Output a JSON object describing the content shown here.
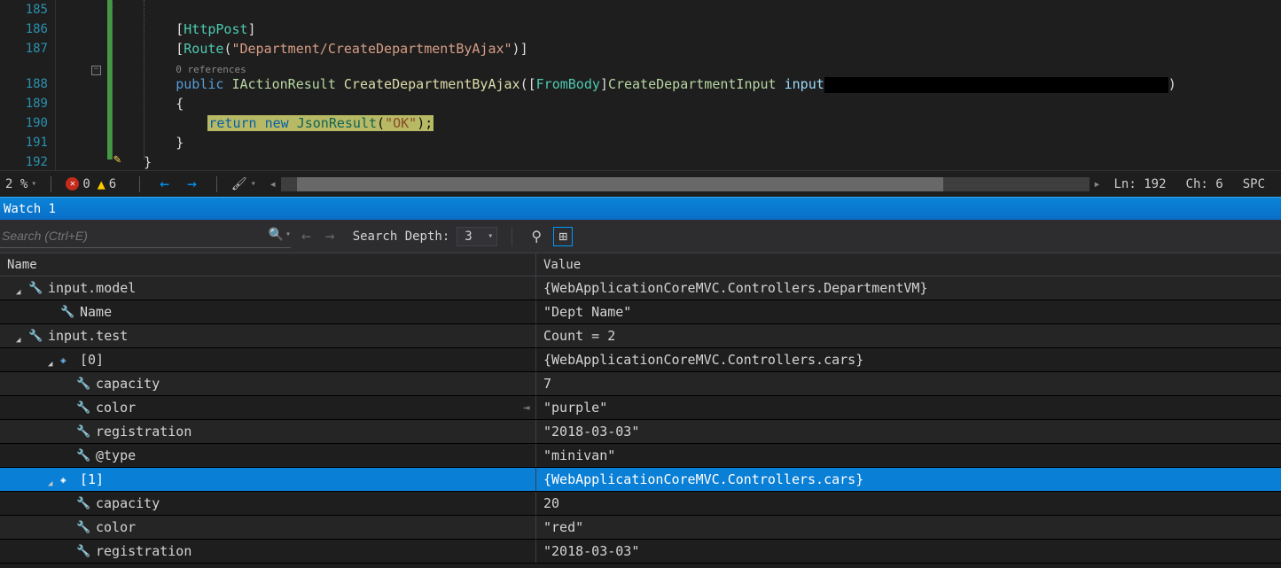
{
  "editor": {
    "lines": [
      "185",
      "186",
      "187",
      "188",
      "189",
      "190",
      "191",
      "192"
    ],
    "codelens": "0 references",
    "attr_httppost": "HttpPost",
    "attr_route": "Route",
    "route_str": "\"Department/CreateDepartmentByAjax\"",
    "kw_public": "public",
    "type_iactionresult": "IActionResult",
    "method_name": "CreateDepartmentByAjax",
    "attr_frombody": "FromBody",
    "type_input": "CreateDepartmentInput",
    "param_input": "input",
    "open_brace": "{",
    "kw_return": "return",
    "kw_new": "new",
    "type_jsonresult": "JsonResult",
    "ok_str": "\"OK\"",
    "close_brace": "}",
    "outer_close": "}"
  },
  "status": {
    "zoom_pct": "2 %",
    "errors": "0",
    "warnings": "6",
    "ln_label": "Ln:",
    "ln_val": "192",
    "ch_label": "Ch:",
    "ch_val": "6",
    "spc": "SPC"
  },
  "panel": {
    "title": "Watch 1"
  },
  "toolbar": {
    "search_placeholder": "Search (Ctrl+E)",
    "depth_label": "Search Depth:",
    "depth_value": "3"
  },
  "columns": {
    "name": "Name",
    "value": "Value"
  },
  "watch": [
    {
      "indent": 1,
      "expander": true,
      "icon": "wrench",
      "name": "input.model",
      "value": "{WebApplicationCoreMVC.Controllers.DepartmentVM}",
      "odd": true
    },
    {
      "indent": 3,
      "expander": false,
      "icon": "wrench",
      "name": "Name",
      "value": "\"Dept Name\"",
      "odd": false
    },
    {
      "indent": 1,
      "expander": true,
      "icon": "wrench",
      "name": "input.test",
      "value": "Count = 2",
      "odd": true
    },
    {
      "indent": 3,
      "expander": true,
      "icon": "box",
      "name": "[0]",
      "value": "{WebApplicationCoreMVC.Controllers.cars}",
      "odd": false
    },
    {
      "indent": 4,
      "expander": false,
      "icon": "wrench",
      "name": "capacity",
      "value": "7",
      "odd": true
    },
    {
      "indent": 4,
      "expander": false,
      "icon": "wrench",
      "name": "color",
      "value": "\"purple\"",
      "odd": false,
      "pin": true
    },
    {
      "indent": 4,
      "expander": false,
      "icon": "wrench",
      "name": "registration",
      "value": "\"2018-03-03\"",
      "odd": true
    },
    {
      "indent": 4,
      "expander": false,
      "icon": "wrench",
      "name": "@type",
      "value": "\"minivan\"",
      "odd": false
    },
    {
      "indent": 3,
      "expander": true,
      "icon": "box",
      "name": "[1]",
      "value": "{WebApplicationCoreMVC.Controllers.cars}",
      "odd": true,
      "selected": true
    },
    {
      "indent": 4,
      "expander": false,
      "icon": "wrench",
      "name": "capacity",
      "value": "20",
      "odd": false
    },
    {
      "indent": 4,
      "expander": false,
      "icon": "wrench",
      "name": "color",
      "value": "\"red\"",
      "odd": true
    },
    {
      "indent": 4,
      "expander": false,
      "icon": "wrench",
      "name": "registration",
      "value": "\"2018-03-03\"",
      "odd": false
    }
  ]
}
